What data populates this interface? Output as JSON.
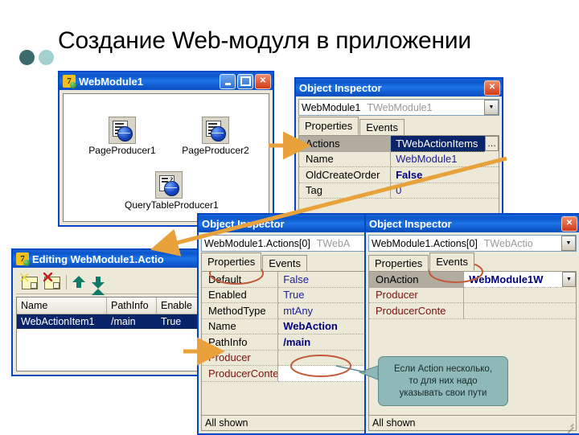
{
  "slide": {
    "title": "Создание Web-модуля в приложении",
    "bullet_dark_color": "#3b6b6b",
    "bullet_light_color": "#a2cfcf"
  },
  "web_module_window": {
    "title": "WebModule1",
    "icon": "delphi-icon",
    "buttons": {
      "minimize": "minimize-button",
      "maximize": "maximize-button",
      "close": "close-button"
    },
    "components": [
      {
        "label": "PageProducer1",
        "icon": "page-producer-icon"
      },
      {
        "label": "PageProducer2",
        "icon": "page-producer-icon"
      },
      {
        "label": "QueryTableProducer1",
        "icon": "query-table-producer-icon"
      }
    ]
  },
  "object_inspector_top": {
    "title": "Object Inspector",
    "close_label": "×",
    "object_name": "WebModule1",
    "object_type": "TWebModule1",
    "tabs": [
      "Properties",
      "Events"
    ],
    "active_tab": "Properties",
    "rows": [
      {
        "key": "Actions",
        "value": "TWebActionItems",
        "selected": true,
        "ellipsis": true
      },
      {
        "key": "Name",
        "value": "WebModule1"
      },
      {
        "key": "OldCreateOrder",
        "value": "False",
        "bold": true
      },
      {
        "key": "Tag",
        "value": "0"
      }
    ]
  },
  "object_inspector_mid": {
    "title": "Object Inspector",
    "object_name": "WebModule1.Actions[0]",
    "object_type": "TWebA",
    "tabs": [
      "Properties",
      "Events"
    ],
    "active_tab": "Properties",
    "rows": [
      {
        "key": "Default",
        "value": "False"
      },
      {
        "key": "Enabled",
        "value": "True"
      },
      {
        "key": "MethodType",
        "value": "mtAny"
      },
      {
        "key": "Name",
        "value": "WebAction",
        "bold": true
      },
      {
        "key": "PathInfo",
        "value": "/main",
        "bold": true
      },
      {
        "key": "Producer",
        "value": "",
        "event": true
      },
      {
        "key": "ProducerConte",
        "value": "",
        "event": true,
        "white": true
      }
    ],
    "status": "All shown"
  },
  "object_inspector_right": {
    "title": "Object Inspector",
    "close_label": "×",
    "object_name": "WebModule1.Actions[0]",
    "object_type": "TWebActio",
    "tabs": [
      "Properties",
      "Events"
    ],
    "active_tab": "Events",
    "rows": [
      {
        "key": "OnAction",
        "value": "WebModule1W",
        "selected": true,
        "dropdown": true,
        "bold": true
      },
      {
        "key": "Producer",
        "value": "",
        "event": true
      },
      {
        "key": "ProducerConte",
        "value": "",
        "event": true
      }
    ],
    "status": "All shown"
  },
  "editing_window": {
    "title": "Editing WebModule1.Actio",
    "icon": "delphi-icon",
    "toolbar": [
      {
        "name": "add-item-button"
      },
      {
        "name": "delete-item-button"
      },
      {
        "name": "move-up-button"
      },
      {
        "name": "move-down-button"
      }
    ],
    "columns": [
      "Name",
      "PathInfo",
      "Enable"
    ],
    "rows": [
      {
        "name": "WebActionItem1",
        "path_info": "/main",
        "enabled": "True"
      }
    ]
  },
  "callout": {
    "lines": [
      "Если Action несколько,",
      "то для них надо",
      "указывать свои пути"
    ],
    "background": "#8fb8b8"
  },
  "annotations": {
    "arrow_color": "#e9a13b",
    "ellipse_color": "#c4593a"
  }
}
